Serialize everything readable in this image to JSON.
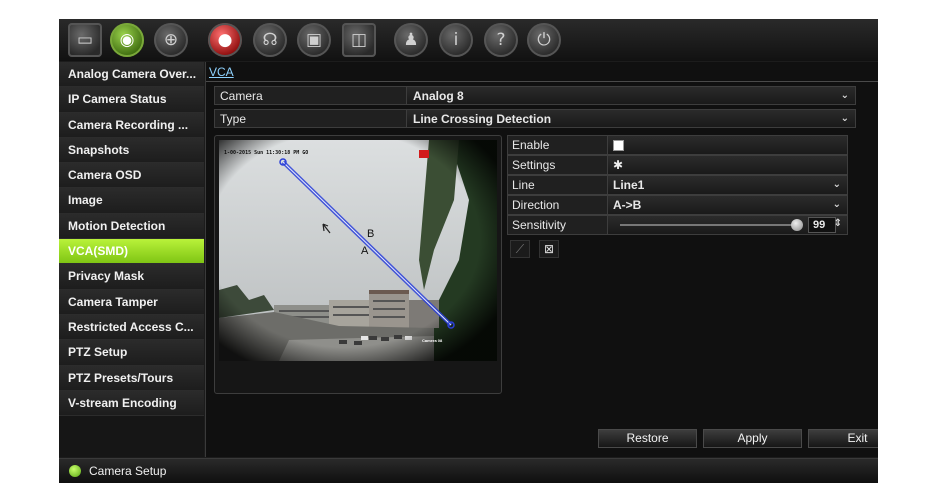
{
  "toolbar": {
    "icons": [
      {
        "name": "monitor-icon",
        "glyph": "▭"
      },
      {
        "name": "camera-icon",
        "glyph": "◉"
      },
      {
        "name": "network-icon",
        "glyph": "⊕"
      },
      {
        "name": "record-icon",
        "glyph": "●"
      },
      {
        "name": "alarm-icon",
        "glyph": "☊"
      },
      {
        "name": "device-icon",
        "glyph": "▣"
      },
      {
        "name": "storage-icon",
        "glyph": "◫"
      },
      {
        "name": "user-icon",
        "glyph": "♟"
      },
      {
        "name": "info-icon",
        "glyph": "i"
      },
      {
        "name": "help-icon",
        "glyph": "?"
      },
      {
        "name": "power-icon",
        "glyph": "⏻"
      }
    ]
  },
  "sidebar": {
    "items": [
      {
        "label": "Analog Camera Over...",
        "active": false
      },
      {
        "label": "IP Camera Status",
        "active": false
      },
      {
        "label": "Camera Recording ...",
        "active": false
      },
      {
        "label": "Snapshots",
        "active": false
      },
      {
        "label": "Camera OSD",
        "active": false
      },
      {
        "label": "Image",
        "active": false
      },
      {
        "label": "Motion Detection",
        "active": false
      },
      {
        "label": "VCA(SMD)",
        "active": true
      },
      {
        "label": "Privacy Mask",
        "active": false
      },
      {
        "label": "Camera Tamper",
        "active": false
      },
      {
        "label": "Restricted Access C...",
        "active": false
      },
      {
        "label": "PTZ Setup",
        "active": false
      },
      {
        "label": "PTZ Presets/Tours",
        "active": false
      },
      {
        "label": "V-stream Encoding",
        "active": false
      }
    ]
  },
  "main": {
    "tab": "VCA",
    "camera_label": "Camera",
    "camera_value": "Analog 8",
    "type_label": "Type",
    "type_value": "Line Crossing Detection"
  },
  "preview": {
    "timestamp": "1-00-2015 Sun 11:30:18 PM GO",
    "marker_a": "A",
    "marker_b": "B",
    "camera_name": "Camera 08"
  },
  "settings": {
    "enable_label": "Enable",
    "enable_checked": false,
    "settings_label": "Settings",
    "settings_icon": "gear-icon",
    "line_label": "Line",
    "line_value": "Line1",
    "direction_label": "Direction",
    "direction_value": "A->B",
    "sensitivity_label": "Sensitivity",
    "sensitivity_value": "99"
  },
  "buttons": {
    "restore": "Restore",
    "apply": "Apply",
    "exit": "Exit"
  },
  "status": {
    "text": "Camera Setup"
  },
  "colors": {
    "accent": "#8fd41e",
    "link": "#8fd3ff",
    "line": "#2a3fd8"
  }
}
